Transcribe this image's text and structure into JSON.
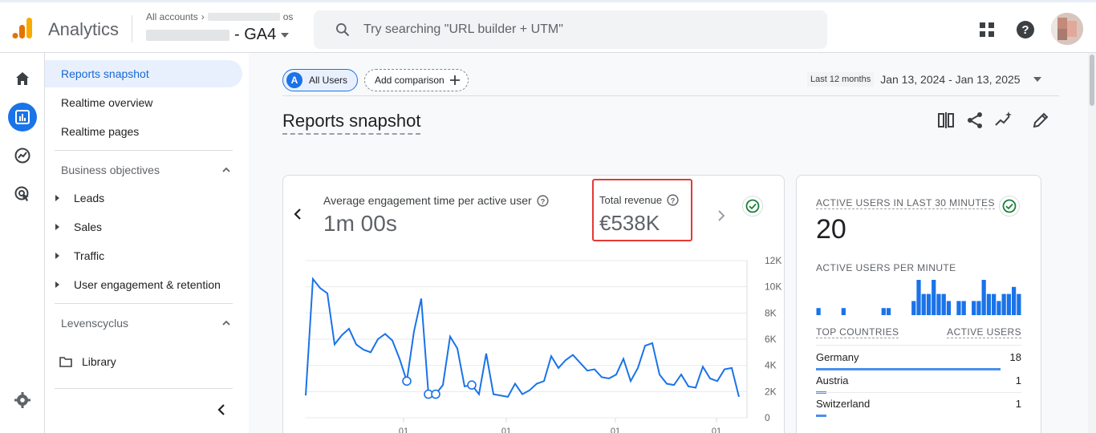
{
  "header": {
    "app_name": "Analytics",
    "breadcrumb_root": "All accounts",
    "breadcrumb_tail": "os",
    "property_suffix": "- GA4",
    "search_placeholder": "Try searching \"URL builder + UTM\""
  },
  "nav": {
    "items": [
      {
        "label": "Reports snapshot"
      },
      {
        "label": "Realtime overview"
      },
      {
        "label": "Realtime pages"
      }
    ],
    "section1": "Business objectives",
    "section1_items": [
      "Leads",
      "Sales",
      "Traffic",
      "User engagement & retention"
    ],
    "section2": "Levenscyclus",
    "library": "Library"
  },
  "toolbar": {
    "comparison_chip": "All Users",
    "comparison_letter": "A",
    "add_comparison": "Add comparison",
    "date_label": "Last 12 months",
    "date_value": "Jan 13, 2024 - Jan 13, 2025"
  },
  "page": {
    "title": "Reports snapshot"
  },
  "metrics": {
    "engagement_label": "Average engagement time per active user",
    "engagement_value": "1m 00s",
    "revenue_label": "Total revenue",
    "revenue_value": "€538K"
  },
  "side": {
    "active_30_label": "ACTIVE USERS IN LAST 30 MINUTES",
    "active_30_value": "20",
    "per_minute_label": "ACTIVE USERS PER MINUTE",
    "per_minute": [
      1,
      0,
      0,
      0,
      0,
      1,
      0,
      0,
      0,
      0,
      0,
      0,
      0,
      1,
      1,
      0,
      0,
      0,
      0,
      2,
      5,
      3,
      3,
      5,
      3,
      3,
      2,
      0,
      2,
      2,
      0,
      2,
      2,
      5,
      3,
      3,
      2,
      3,
      3,
      4,
      3
    ],
    "top_countries_label": "TOP COUNTRIES",
    "active_users_label": "ACTIVE USERS",
    "countries": [
      {
        "name": "Germany",
        "value": "18",
        "share": 0.9
      },
      {
        "name": "Austria",
        "value": "1",
        "share": 0.05
      },
      {
        "name": "Switzerland",
        "value": "1",
        "share": 0.05
      }
    ]
  },
  "chart_data": {
    "type": "line",
    "ylim": [
      0,
      12000
    ],
    "y_ticks": [
      "12K",
      "10K",
      "8K",
      "6K",
      "4K",
      "2K",
      "0"
    ],
    "x_tick_labels": [
      "01",
      "01",
      "01",
      "01"
    ],
    "series": [
      {
        "values": [
          1700,
          10600,
          9900,
          9500,
          5600,
          6300,
          6800,
          5600,
          5200,
          5000,
          6000,
          6400,
          5900,
          4500,
          2800,
          6600,
          9100,
          1800,
          1800,
          2500,
          6200,
          5300,
          2400,
          2500,
          1800,
          4900,
          1800,
          1700,
          1600,
          2600,
          1800,
          2100,
          2600,
          2800,
          4700,
          3800,
          4400,
          4800,
          4200,
          3600,
          3700,
          3100,
          3000,
          3300,
          4500,
          2800,
          3800,
          5500,
          5700,
          3300,
          2600,
          2500,
          3300,
          2400,
          2300,
          3900,
          3000,
          2800,
          3700,
          3800,
          1600
        ],
        "markers": [
          14,
          17,
          18,
          23
        ]
      }
    ]
  },
  "colors": {
    "accent": "#1a73e8",
    "highlight_box": "#e53935",
    "line": "#1a73e8"
  }
}
